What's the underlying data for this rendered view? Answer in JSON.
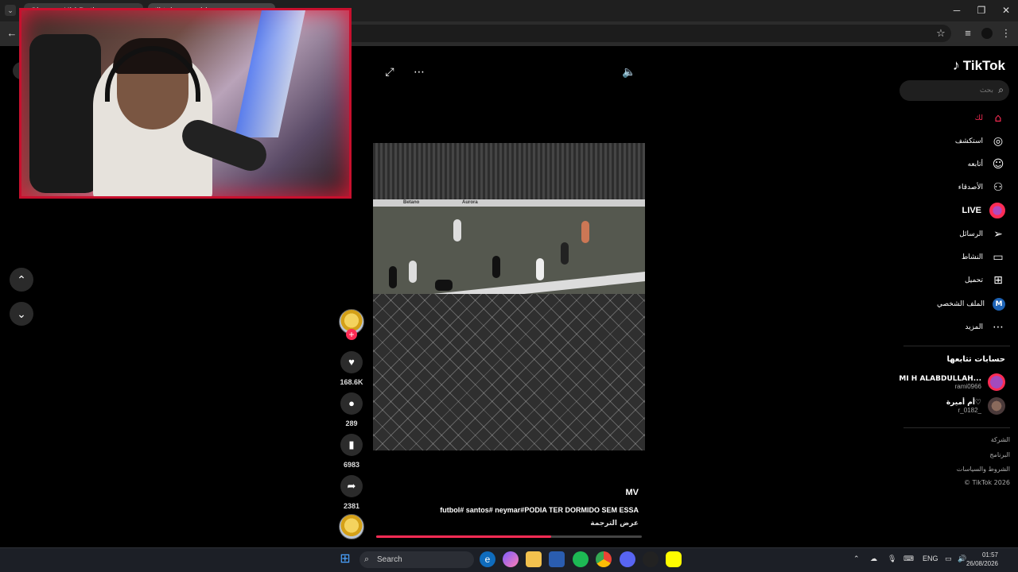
{
  "browser": {
    "tabs": [
      {
        "label": "Chrome Kid Dating"
      },
      {
        "label": "tiktok.com video"
      }
    ],
    "window_controls": {
      "minimize": "─",
      "maximize": "❐",
      "close": "✕"
    },
    "toolbar": {
      "back": "←",
      "star": "☆",
      "menu": "⋮"
    }
  },
  "player": {
    "expand": "⤢",
    "more": "⋯",
    "volume": "🔈",
    "nav_up": "⌃",
    "nav_down": "⌄"
  },
  "video": {
    "brands": [
      "Betano",
      "Aurora"
    ]
  },
  "actions": {
    "likes": "168.6K",
    "comments": "289",
    "saves": "6983",
    "shares": "2381",
    "plus": "+"
  },
  "caption": {
    "author": "MV",
    "text": "futbol# santos# neymar#PODIA TER DORMIDO SEM ESSA",
    "translate": "عرض الترجمة",
    "progress": 0.66
  },
  "sidebar": {
    "logo": "TikTok",
    "search_placeholder": "بحث",
    "nav": [
      {
        "label": "لك",
        "icon": "home-icon"
      },
      {
        "label": "استكشف",
        "icon": "compass-icon"
      },
      {
        "label": "أتابعه",
        "icon": "following-icon"
      },
      {
        "label": "الأصدقاء",
        "icon": "friends-icon"
      },
      {
        "label": "LIVE",
        "icon": "live-icon"
      },
      {
        "label": "الرسائل",
        "icon": "messages-icon"
      },
      {
        "label": "النشاط",
        "icon": "activity-icon"
      },
      {
        "label": "تحميل",
        "icon": "upload-icon"
      },
      {
        "label": "الملف الشخصي",
        "icon": "profile-icon",
        "initial": "M"
      },
      {
        "label": "المزيد",
        "icon": "more-icon"
      }
    ],
    "following_title": "حسابات تتابعها",
    "following": [
      {
        "name": "MI H ALABDULLAH...",
        "user": "rami0966"
      },
      {
        "name": "أم أميرة♡",
        "user": "r_0182_"
      }
    ],
    "footer": [
      "الشركة",
      "البرنامج",
      "الشروط والسياسات",
      "© TikTok 2026"
    ]
  },
  "taskbar": {
    "search": "Search",
    "lang": "ENG",
    "time": "01:57",
    "date": "26/08/2026"
  },
  "colors": {
    "accent": "#fe2c55",
    "background": "#000000"
  }
}
